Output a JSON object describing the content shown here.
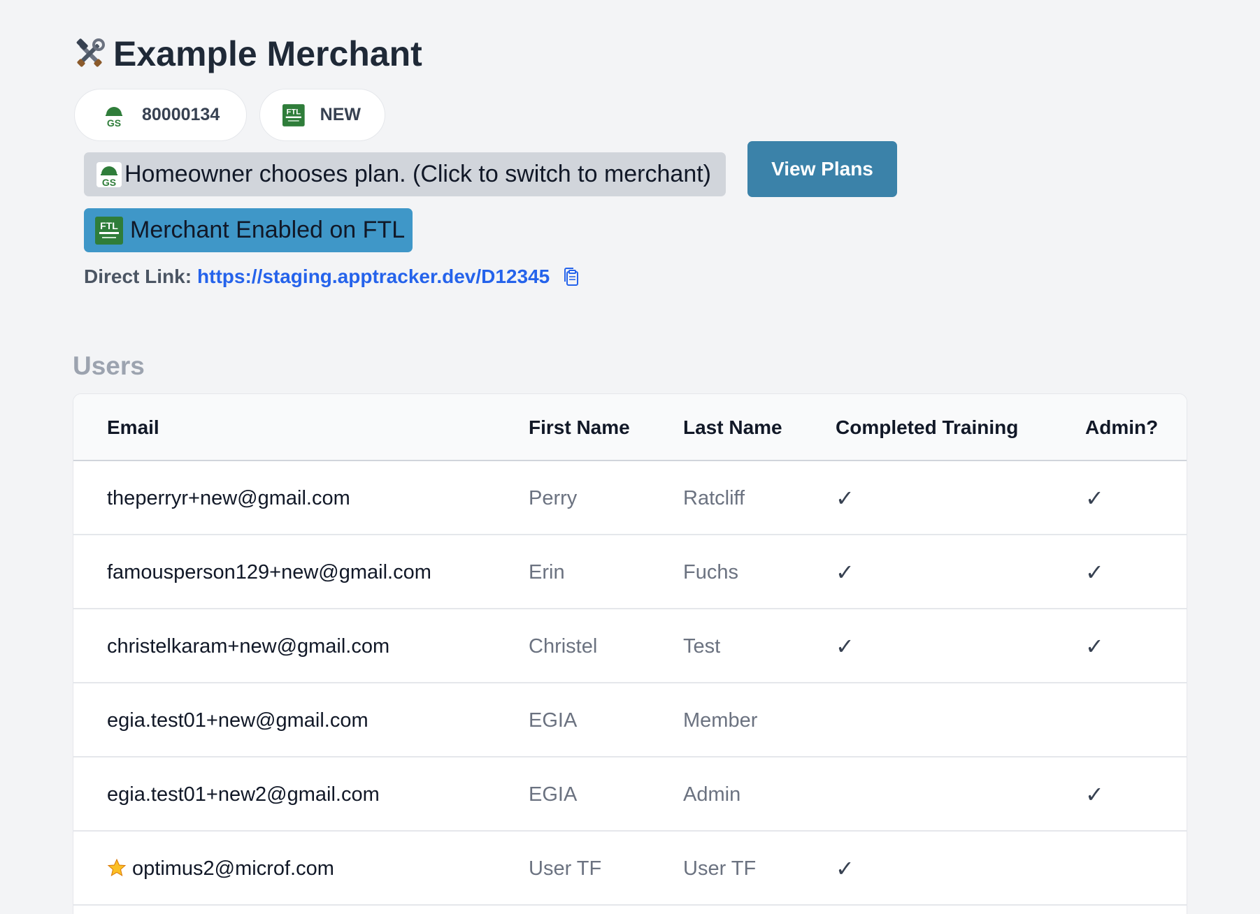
{
  "header": {
    "title": "Example Merchant",
    "title_icon": "hammer-and-wrench-icon"
  },
  "badges": {
    "merchant_id": "80000134",
    "merchant_id_icon": "gs-logo",
    "lender_status": "NEW",
    "lender_icon": "ftl-logo"
  },
  "actions": {
    "choose_plan_label": "Homeowner chooses plan. (Click to switch to merchant)",
    "view_plans_label": "View Plans",
    "ftl_enabled_label": "Merchant Enabled on FTL"
  },
  "direct_link": {
    "label": "Direct Link:",
    "url": "https://staging.apptracker.dev/D12345",
    "copy_icon": "clipboard-copy-icon"
  },
  "users": {
    "title": "Users",
    "columns": [
      "Email",
      "First Name",
      "Last Name",
      "Completed Training",
      "Admin?"
    ],
    "check_glyph": "✓",
    "rows": [
      {
        "email": "theperryr+new@gmail.com",
        "first": "Perry",
        "last": "Ratcliff",
        "training": true,
        "admin": true,
        "starred": false
      },
      {
        "email": "famousperson129+new@gmail.com",
        "first": "Erin",
        "last": "Fuchs",
        "training": true,
        "admin": true,
        "starred": false
      },
      {
        "email": "christelkaram+new@gmail.com",
        "first": "Christel",
        "last": "Test",
        "training": true,
        "admin": true,
        "starred": false
      },
      {
        "email": "egia.test01+new@gmail.com",
        "first": "EGIA",
        "last": "Member",
        "training": false,
        "admin": false,
        "starred": false
      },
      {
        "email": "egia.test01+new2@gmail.com",
        "first": "EGIA",
        "last": "Admin",
        "training": false,
        "admin": true,
        "starred": false
      },
      {
        "email": "optimus2@microf.com",
        "first": "User TF",
        "last": "User TF",
        "training": true,
        "admin": false,
        "starred": true
      }
    ]
  },
  "colors": {
    "background": "#f3f4f6",
    "view_plans_button": "#3b82a9",
    "ftl_enabled": "#3f97c8",
    "link": "#2563eb",
    "gs_green": "#2f7d3a"
  }
}
